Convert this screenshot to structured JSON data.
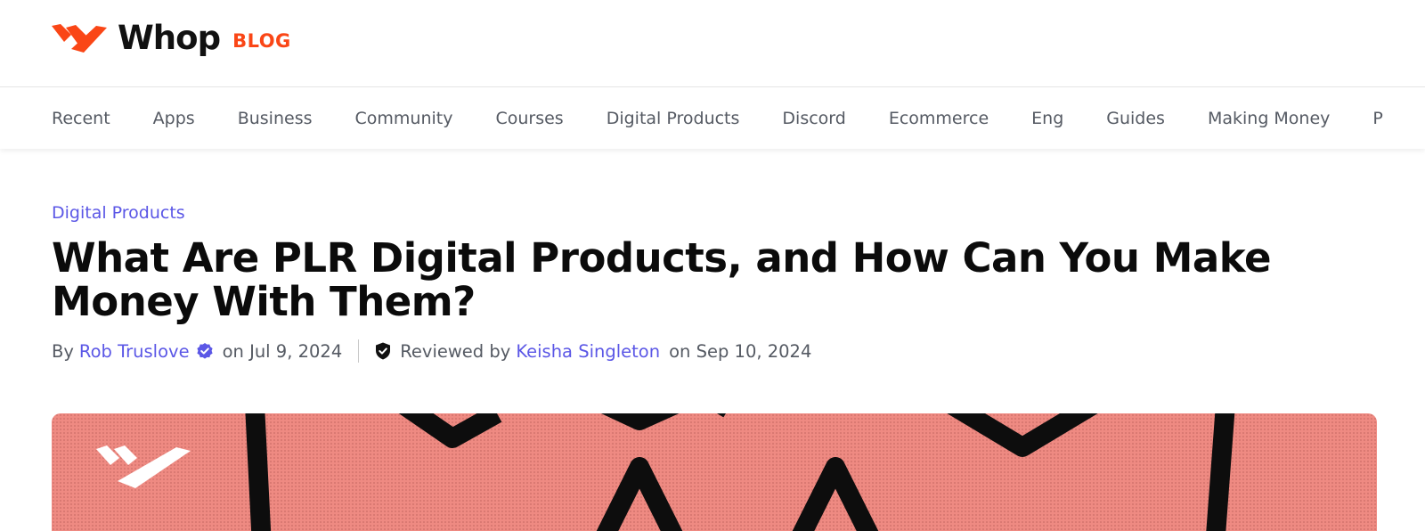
{
  "header": {
    "logo_text": "Whop",
    "logo_sub": "BLOG"
  },
  "nav": {
    "categories": [
      "Recent",
      "Apps",
      "Business",
      "Community",
      "Courses",
      "Digital Products",
      "Discord",
      "Ecommerce",
      "Eng",
      "Guides",
      "Making Money",
      "P"
    ]
  },
  "article": {
    "category": "Digital Products",
    "title": "What Are PLR Digital Products, and How Can You Make Money With Them?",
    "by_label": "By",
    "author": "Rob Truslove",
    "author_date": "on Jul 9, 2024",
    "reviewed_label": "Reviewed by",
    "reviewer": "Keisha Singleton",
    "reviewer_date": "on Sep 10, 2024"
  },
  "colors": {
    "brand": "#fa4616",
    "link": "#5b57e6",
    "hero_bg": "#ef8a82"
  },
  "icons": {
    "logo": "whop-logo-icon",
    "verified": "verified-badge-icon",
    "reviewed": "shield-check-icon"
  }
}
